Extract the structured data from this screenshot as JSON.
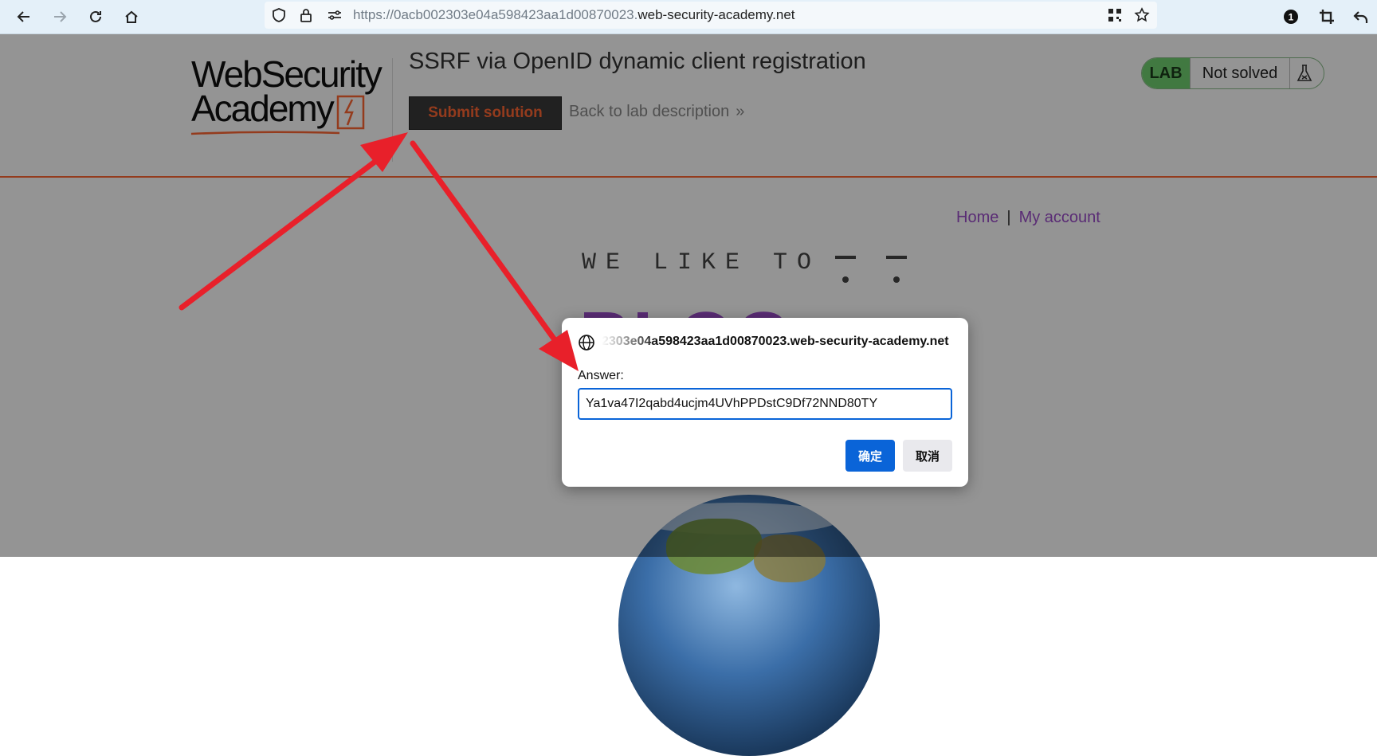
{
  "browser": {
    "url_dim": "https://0acb002303e04a598423aa1d00870023.",
    "url_domain": "web-security-academy.net",
    "notification_count": "1"
  },
  "header": {
    "logo_line1": "WebSecurity",
    "logo_line2": "Academy",
    "lab_title": "SSRF via OpenID dynamic client registration",
    "submit_label": "Submit solution",
    "back_label": "Back to lab description",
    "back_chevrons": "»",
    "lab_tag": "LAB",
    "lab_status": "Not solved"
  },
  "nav": {
    "home": "Home",
    "separator": "|",
    "account": "My account"
  },
  "blog": {
    "tagline": "WE LIKE TO",
    "big_word": "BLOG"
  },
  "dialog": {
    "origin": "2303e04a598423aa1d00870023.web-security-academy.net",
    "label": "Answer:",
    "answer_value": "Ya1va47I2qabd4ucjm4UVhPPDstC9Df72NND80TY",
    "ok_label": "确定",
    "cancel_label": "取消"
  },
  "colors": {
    "accent": "#ff6633",
    "link": "#9b4dca",
    "primary_button": "#0a64d8",
    "annotation_arrow": "#e8202a"
  },
  "icons": [
    "back-icon",
    "forward-icon",
    "reload-icon",
    "home-icon",
    "shield-icon",
    "lock-icon",
    "permissions-icon",
    "qr-code-icon",
    "bookmark-star-icon",
    "extension-icon",
    "crop-icon",
    "undo-icon",
    "flask-icon",
    "globe-icon"
  ]
}
